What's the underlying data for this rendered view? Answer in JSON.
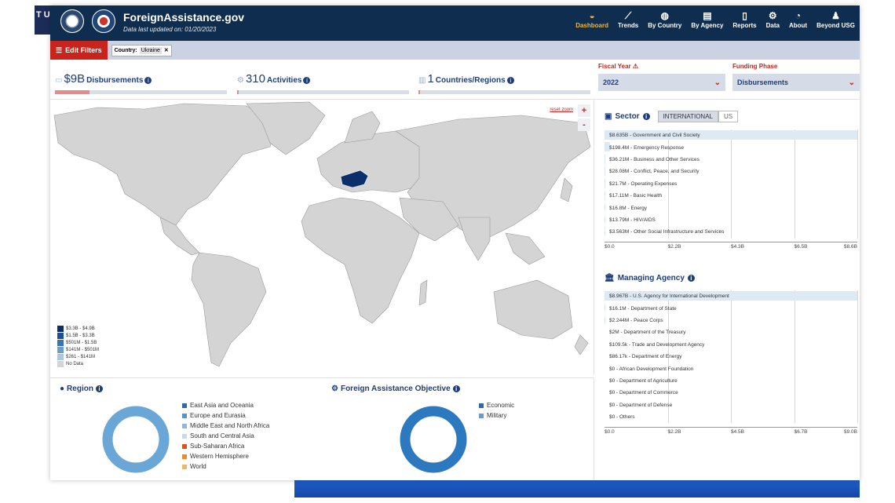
{
  "background": {
    "left_window_text": "T US"
  },
  "header": {
    "title": "ForeignAssistance.gov",
    "subtitle": "Data last updated on: 01/20/2023",
    "nav": [
      {
        "label": "Dashboard",
        "icon": "dashboard-gauge-icon",
        "active": true
      },
      {
        "label": "Trends",
        "icon": "line-chart-icon",
        "active": false
      },
      {
        "label": "By Country",
        "icon": "globe-icon",
        "active": false
      },
      {
        "label": "By Agency",
        "icon": "building-icon",
        "active": false
      },
      {
        "label": "Reports",
        "icon": "document-icon",
        "active": false
      },
      {
        "label": "Data",
        "icon": "gears-icon",
        "active": false
      },
      {
        "label": "About",
        "icon": "compass-icon",
        "active": false
      },
      {
        "label": "Beyond USG",
        "icon": "person-icon",
        "active": false
      }
    ]
  },
  "filters": {
    "edit_label": "Edit Filters",
    "chip_key": "Country:",
    "chip_value": "Ukraine",
    "chip_remove": "✕"
  },
  "stats": {
    "disbursements": {
      "value": "$9B",
      "label": "Disbursements",
      "fill": 0.2
    },
    "activities": {
      "value": "310",
      "label": "Activities",
      "fill": 0.0
    },
    "countries": {
      "value": "1",
      "label": "Countries/Regions",
      "fill": 0.0
    }
  },
  "selectors": {
    "fiscal_year": {
      "label": "Fiscal Year",
      "value": "2022"
    },
    "funding_phase": {
      "label": "Funding Phase",
      "value": "Disbursements"
    }
  },
  "map": {
    "reset_zoom": "reset zoom",
    "zoom_in": "+",
    "zoom_out": "-",
    "legend": [
      {
        "label": "$3.3B - $4.9B",
        "color": "#0b2f6b"
      },
      {
        "label": "$1.5B - $3.3B",
        "color": "#1b4f96"
      },
      {
        "label": "$501M - $1.5B",
        "color": "#3a74b8"
      },
      {
        "label": "$141M - $501M",
        "color": "#6c9ccf"
      },
      {
        "label": "$261 - $141M",
        "color": "#a9c6e6"
      },
      {
        "label": "No Data",
        "color": "#d4d4d4"
      }
    ]
  },
  "region": {
    "title": "Region",
    "items": [
      {
        "label": "East Asia and Oceania",
        "color": "#2d6aa8"
      },
      {
        "label": "Europe and Eurasia",
        "color": "#5a92c6"
      },
      {
        "label": "Middle East and North Africa",
        "color": "#8fb6dd"
      },
      {
        "label": "South and Central Asia",
        "color": "#c6d9ee"
      },
      {
        "label": "Sub-Saharan Africa",
        "color": "#d9531e"
      },
      {
        "label": "Western Hemisphere",
        "color": "#ef8b2c"
      },
      {
        "label": "World",
        "color": "#f4b26b"
      }
    ]
  },
  "objective": {
    "title": "Foreign Assistance Objective",
    "items": [
      {
        "label": "Economic",
        "color": "#2d6aa8"
      },
      {
        "label": "Military",
        "color": "#6c9ccf"
      }
    ]
  },
  "sector": {
    "title": "Sector",
    "toggle": [
      "INTERNATIONAL",
      "US"
    ],
    "rows": [
      {
        "label": "$8.635B - Government and Civil Society",
        "value": 8.635
      },
      {
        "label": "$198.4M - Emergency Response",
        "value": 0.1984
      },
      {
        "label": "$36.21M - Business and Other Services",
        "value": 0.03621
      },
      {
        "label": "$28.08M - Conflict, Peace, and Security",
        "value": 0.02808
      },
      {
        "label": "$21.7M - Operating Expenses",
        "value": 0.0217
      },
      {
        "label": "$17.11M - Basic Health",
        "value": 0.01711
      },
      {
        "label": "$16.8M - Energy",
        "value": 0.0168
      },
      {
        "label": "$13.79M - HIV/AIDS",
        "value": 0.01379
      },
      {
        "label": "$3.563M - Other Social Infrastructure and Services",
        "value": 0.003563
      }
    ],
    "ticks": [
      "$0.0",
      "$2.2B",
      "$4.3B",
      "$6.5B",
      "$8.6B"
    ],
    "max": 8.635
  },
  "agency": {
    "title": "Managing Agency",
    "rows": [
      {
        "label": "$8.967B - U.S. Agency for International Development",
        "value": 8.967
      },
      {
        "label": "$16.1M - Department of State",
        "value": 0.0161
      },
      {
        "label": "$2.244M - Peace Corps",
        "value": 0.002244
      },
      {
        "label": "$2M - Department of the Treasury",
        "value": 0.002
      },
      {
        "label": "$109.5k - Trade and Development Agency",
        "value": 0.0001095
      },
      {
        "label": "$86.17k - Department of Energy",
        "value": 8.617e-05
      },
      {
        "label": "$0 - African Development Foundation",
        "value": 0
      },
      {
        "label": "$0 - Department of Agriculture",
        "value": 0
      },
      {
        "label": "$0 - Department of Commerce",
        "value": 0
      },
      {
        "label": "$0 - Department of Defense",
        "value": 0
      },
      {
        "label": "$0 - Others",
        "value": 0
      }
    ],
    "ticks": [
      "$0.0",
      "$2.2B",
      "$4.5B",
      "$6.7B",
      "$9.0B"
    ],
    "max": 8.967
  }
}
